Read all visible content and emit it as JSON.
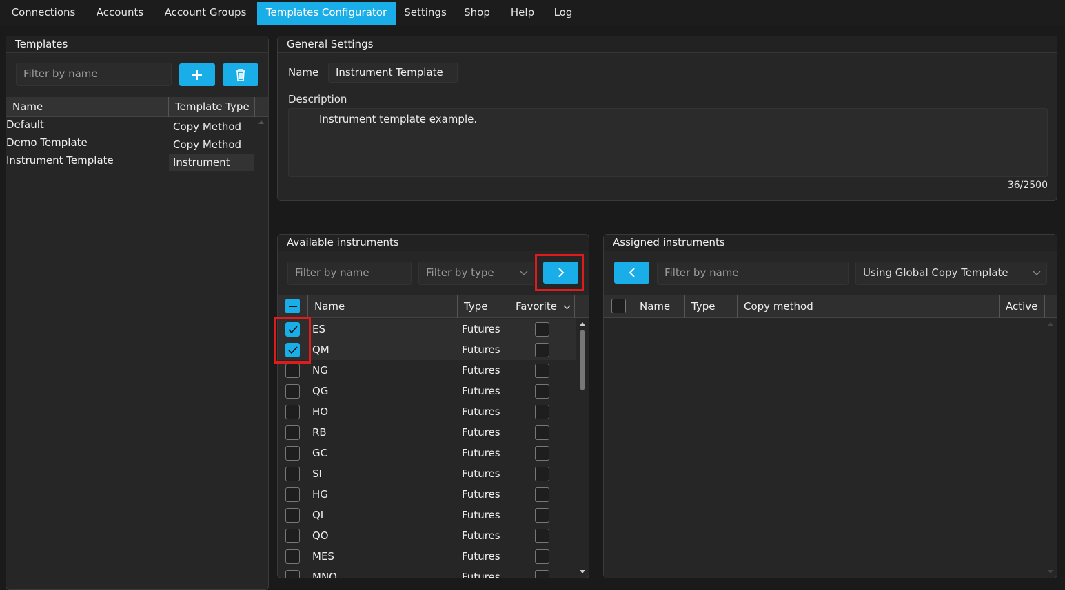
{
  "nav": {
    "tabs": [
      {
        "label": "Connections"
      },
      {
        "label": "Accounts"
      },
      {
        "label": "Account Groups"
      },
      {
        "label": "Templates Configurator"
      },
      {
        "label": "Settings"
      },
      {
        "label": "Shop"
      },
      {
        "label": "Help"
      },
      {
        "label": "Log"
      }
    ],
    "active_tab": "Templates Configurator"
  },
  "templates_panel": {
    "title": "Templates",
    "filter_placeholder": "Filter by name",
    "columns": [
      "Name",
      "Template Type"
    ],
    "rows": [
      {
        "name": "Default",
        "type": "Copy Method"
      },
      {
        "name": "Demo Template",
        "type": "Copy Method"
      },
      {
        "name": "Instrument Template",
        "type": "Instrument"
      }
    ],
    "selected_row": "Instrument Template"
  },
  "general_settings": {
    "title": "General Settings",
    "name_label": "Name",
    "name_value": "Instrument Template",
    "description_label": "Description",
    "description_value": "Instrument template example.",
    "char_count": "36/2500"
  },
  "available": {
    "title": "Available instruments",
    "filter_name_placeholder": "Filter by name",
    "filter_type_placeholder": "Filter by type",
    "columns": [
      "Name",
      "Type",
      "Favorite"
    ],
    "rows": [
      {
        "name": "ES",
        "type": "Futures",
        "checked": true
      },
      {
        "name": "QM",
        "type": "Futures",
        "checked": true
      },
      {
        "name": "NG",
        "type": "Futures",
        "checked": false
      },
      {
        "name": "QG",
        "type": "Futures",
        "checked": false
      },
      {
        "name": "HO",
        "type": "Futures",
        "checked": false
      },
      {
        "name": "RB",
        "type": "Futures",
        "checked": false
      },
      {
        "name": "GC",
        "type": "Futures",
        "checked": false
      },
      {
        "name": "SI",
        "type": "Futures",
        "checked": false
      },
      {
        "name": "HG",
        "type": "Futures",
        "checked": false
      },
      {
        "name": "QI",
        "type": "Futures",
        "checked": false
      },
      {
        "name": "QO",
        "type": "Futures",
        "checked": false
      },
      {
        "name": "MES",
        "type": "Futures",
        "checked": false
      },
      {
        "name": "MNQ",
        "type": "Futures",
        "checked": false
      }
    ]
  },
  "assigned": {
    "title": "Assigned instruments",
    "filter_name_placeholder": "Filter by name",
    "copy_template_value": "Using Global Copy Template",
    "columns": [
      "Name",
      "Type",
      "Copy method",
      "Active"
    ]
  },
  "colors": {
    "accent": "#1aaee8",
    "highlight": "#e01b1b",
    "background": "#1a1a1a"
  },
  "icons": [
    "plus-icon",
    "trash-icon",
    "chevron-right-icon",
    "chevron-left-icon",
    "chevron-down-icon",
    "checkmark-icon",
    "minus-icon"
  ]
}
